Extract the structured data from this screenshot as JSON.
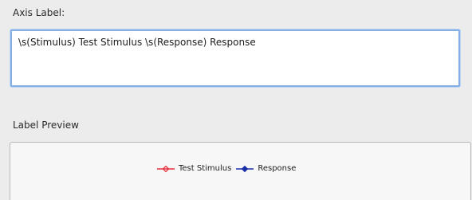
{
  "axis_label": {
    "heading": "Axis Label:",
    "value": "\\s(Stimulus) Test Stimulus \\s(Response) Response"
  },
  "label_preview": {
    "heading": "Label Preview",
    "legend": [
      {
        "label": "Test Stimulus",
        "color": "#e8323f",
        "marker": "diamond-icon"
      },
      {
        "label": "Response",
        "color": "#1a2ea8",
        "marker": "diamond-icon"
      }
    ]
  }
}
